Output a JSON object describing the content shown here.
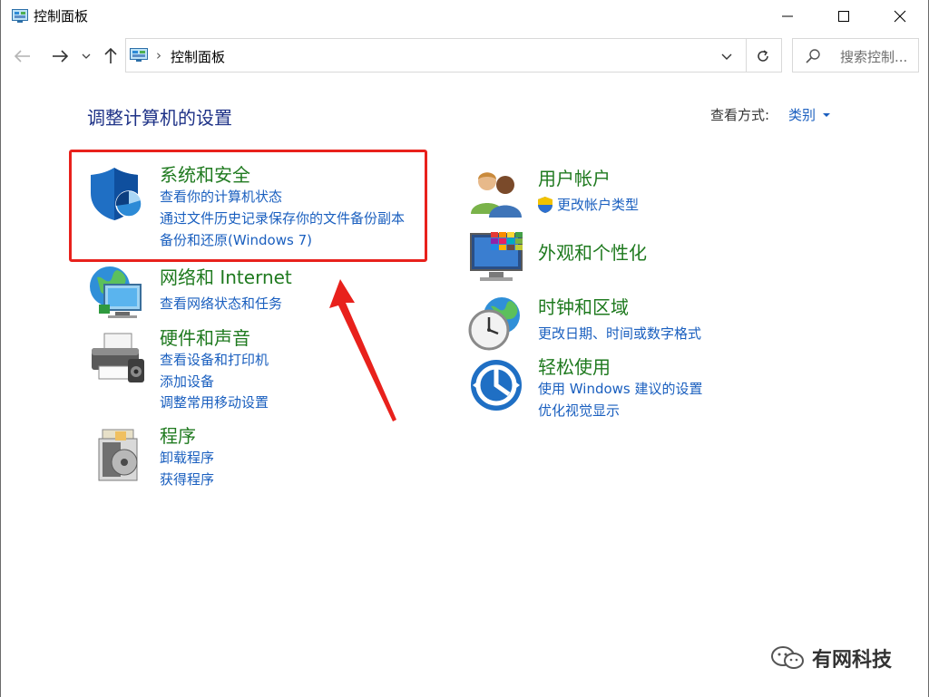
{
  "window": {
    "title": "控制面板"
  },
  "nav": {
    "address_text": "控制面板",
    "address_separator": "›",
    "search_placeholder": "搜索控制..."
  },
  "content": {
    "page_title": "调整计算机的设置",
    "view_by_label": "查看方式:",
    "view_by_value": "类别"
  },
  "categories_left": [
    {
      "title": "系统和安全",
      "links": [
        "查看你的计算机状态",
        "通过文件历史记录保存你的文件备份副本",
        "备份和还原(Windows 7)"
      ],
      "icon": "shield-icon"
    },
    {
      "title": "网络和 Internet",
      "links": [
        "查看网络状态和任务"
      ],
      "icon": "network-globe-icon"
    },
    {
      "title": "硬件和声音",
      "links": [
        "查看设备和打印机",
        "添加设备",
        "调整常用移动设置"
      ],
      "icon": "printer-icon"
    },
    {
      "title": "程序",
      "links": [
        "卸载程序",
        "获得程序"
      ],
      "icon": "programs-icon"
    }
  ],
  "categories_right": [
    {
      "title": "用户帐户",
      "links": [
        "更改帐户类型"
      ],
      "icon": "users-icon"
    },
    {
      "title": "外观和个性化",
      "links": [],
      "icon": "appearance-icon"
    },
    {
      "title": "时钟和区域",
      "links": [
        "更改日期、时间或数字格式"
      ],
      "icon": "clock-globe-icon"
    },
    {
      "title": "轻松使用",
      "links": [
        "使用 Windows 建议的设置",
        "优化视觉显示"
      ],
      "icon": "ease-of-access-icon"
    }
  ],
  "watermark": {
    "text": "有网科技"
  },
  "colors": {
    "title_green": "#1f7a1f",
    "link_blue": "#1a5fbf",
    "heading_blue": "#1e3287",
    "highlight_red": "#e8211c"
  }
}
